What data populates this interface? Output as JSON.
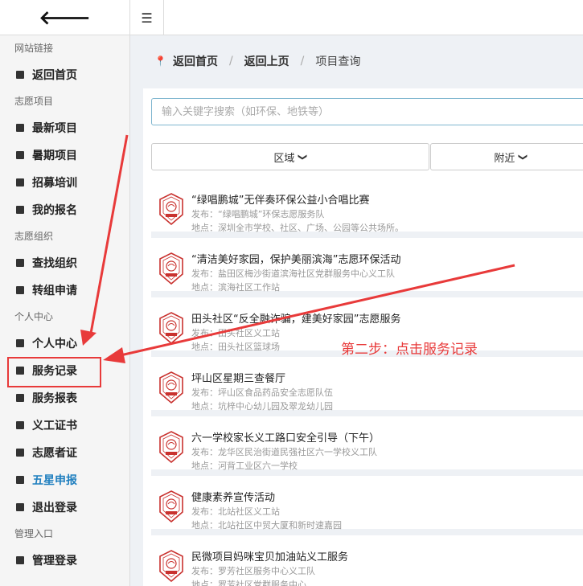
{
  "sidebar": {
    "sections": [
      {
        "title": "网站链接",
        "items": [
          {
            "label": "返回首页"
          }
        ]
      },
      {
        "title": "志愿项目",
        "items": [
          {
            "label": "最新项目"
          },
          {
            "label": "暑期项目"
          },
          {
            "label": "招募培训"
          },
          {
            "label": "我的报名"
          }
        ]
      },
      {
        "title": "志愿组织",
        "items": [
          {
            "label": "查找组织"
          },
          {
            "label": "转组申请"
          }
        ]
      },
      {
        "title": "个人中心",
        "items": [
          {
            "label": "个人中心"
          },
          {
            "label": "服务记录"
          },
          {
            "label": "服务报表"
          },
          {
            "label": "义工证书"
          },
          {
            "label": "志愿者证"
          },
          {
            "label": "五星申报"
          },
          {
            "label": "退出登录"
          }
        ]
      },
      {
        "title": "管理入口",
        "items": [
          {
            "label": "管理登录"
          }
        ]
      }
    ],
    "highlight_color": "#1f7fbf"
  },
  "breadcrumb": {
    "home": "返回首页",
    "up": "返回上页",
    "current": "项目查询"
  },
  "search": {
    "placeholder": "输入关键字搜索（如环保、地铁等）"
  },
  "filters": {
    "region": "区域",
    "nearby": "附近"
  },
  "projects": [
    {
      "title": "“绿唱鹏城”无伴奏环保公益小合唱比赛",
      "publisher": "发布：“绿唱鹏城”环保志愿服务队",
      "location": "地点：深圳全市学校、社区、广场、公园等公共场所。"
    },
    {
      "title": "“清洁美好家园，保护美丽滨海”志愿环保活动",
      "publisher": "发布：盐田区梅沙街道滨海社区党群服务中心义工队",
      "location": "地点：滨海社区工作站"
    },
    {
      "title": "田头社区“反全融诈骗，建美好家园”志愿服务",
      "publisher": "发布：田头社区义工站",
      "location": "地点：田头社区篮球场"
    },
    {
      "title": "坪山区星期三查餐厅",
      "publisher": "发布：坪山区食品药品安全志愿队伍",
      "location": "地点：坑梓中心幼儿园及翠龙幼儿园"
    },
    {
      "title": "六一学校家长义工路口安全引导（下午）",
      "publisher": "发布：龙华区民治街道民强社区六一学校义工队",
      "location": "地点：河背工业区六一学校"
    },
    {
      "title": "健康素养宣传活动",
      "publisher": "发布：北站社区义工站",
      "location": "地点：北站社区中贸大厦和新时速嘉园"
    },
    {
      "title": "民微项目妈咪宝贝加油站义工服务",
      "publisher": "发布：罗芳社区服务中心义工队",
      "location": "地点：罗芳社区党群服务中心"
    }
  ],
  "annotation": {
    "note": "第二步：点击服务记录",
    "color": "#e83a3a"
  }
}
